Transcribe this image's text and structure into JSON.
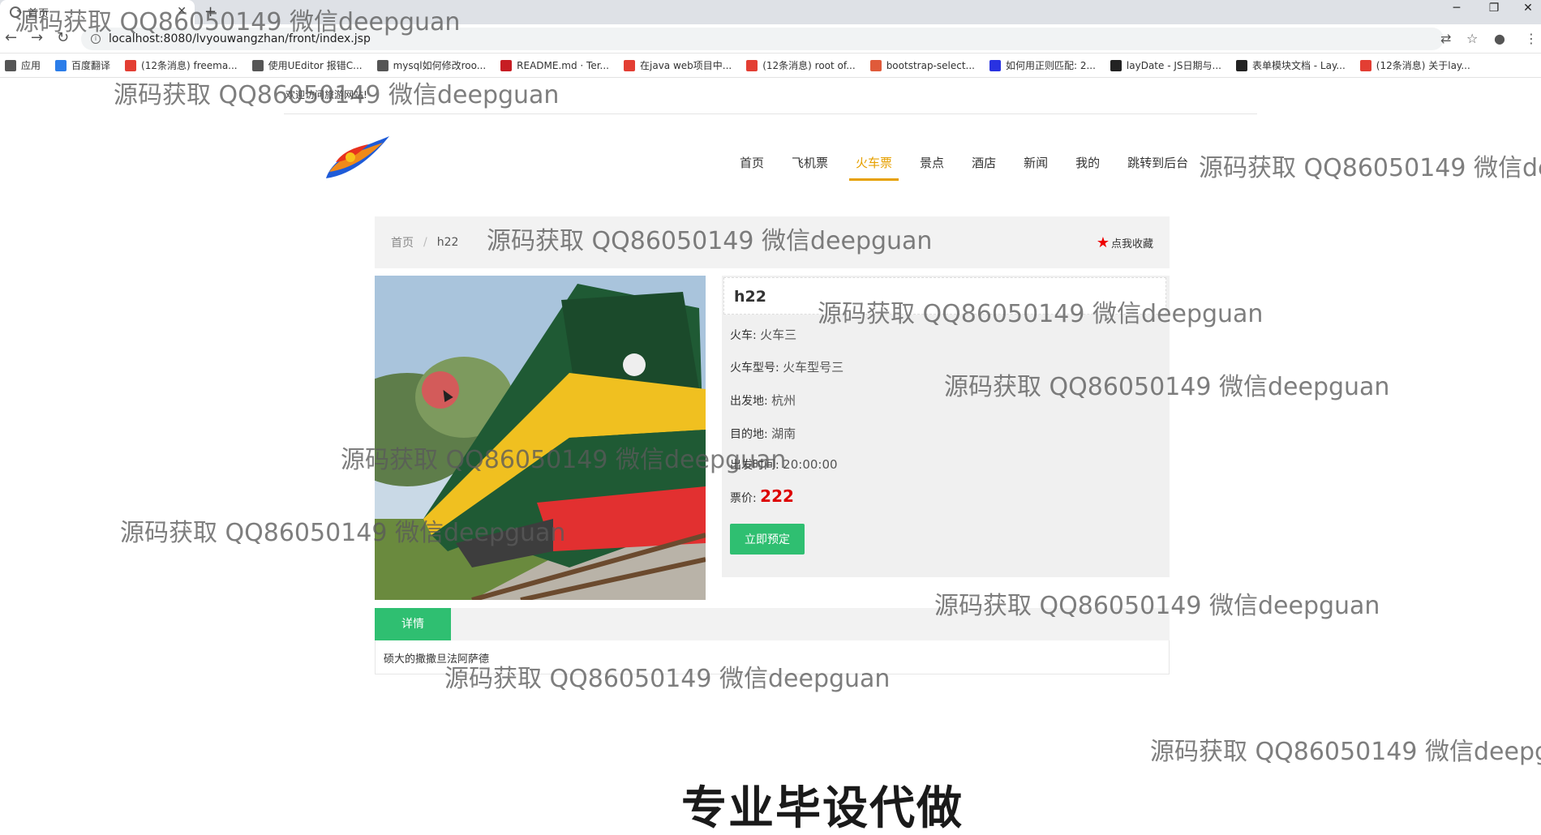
{
  "browser": {
    "tab_title": "首页",
    "url": "localhost:8080/lvyouwangzhan/front/index.jsp",
    "bookmarks": [
      {
        "label": "应用",
        "icon": "apps-icon",
        "color": "#555555"
      },
      {
        "label": "百度翻译",
        "icon": "baidu-translate-icon",
        "color": "#2b7de9"
      },
      {
        "label": "(12条消息) freema...",
        "icon": "csdn-icon",
        "color": "#e33e33"
      },
      {
        "label": "使用UEditor 报错C...",
        "icon": "lambda-icon",
        "color": "#555555"
      },
      {
        "label": "mysql如何修改roo...",
        "icon": "lambda-icon",
        "color": "#555555"
      },
      {
        "label": "README.md · Ter...",
        "icon": "gitee-icon",
        "color": "#c71d23"
      },
      {
        "label": "在java web项目中...",
        "icon": "csdn-icon",
        "color": "#e33e33"
      },
      {
        "label": "(12条消息) root of...",
        "icon": "csdn-icon",
        "color": "#e33e33"
      },
      {
        "label": "bootstrap-select...",
        "icon": "page-icon",
        "color": "#e05a3a"
      },
      {
        "label": "如何用正则匹配: 2...",
        "icon": "baidu-paw-icon",
        "color": "#2932e1"
      },
      {
        "label": "layDate - JS日期与...",
        "icon": "layui-icon",
        "color": "#222222"
      },
      {
        "label": "表单模块文档 - Lay...",
        "icon": "layui-icon",
        "color": "#222222"
      },
      {
        "label": "(12条消息) 关于lay...",
        "icon": "csdn-icon",
        "color": "#e33e33"
      }
    ]
  },
  "site": {
    "welcome": "欢迎访问旅游网站!",
    "nav": [
      {
        "label": "首页",
        "active": false
      },
      {
        "label": "飞机票",
        "active": false
      },
      {
        "label": "火车票",
        "active": true
      },
      {
        "label": "景点",
        "active": false
      },
      {
        "label": "酒店",
        "active": false
      },
      {
        "label": "新闻",
        "active": false
      },
      {
        "label": "我的",
        "active": false
      },
      {
        "label": "跳转到后台",
        "active": false
      }
    ],
    "accent_color": "#e6a000",
    "primary_color": "#2fbf71"
  },
  "breadcrumb": {
    "home": "首页",
    "separator": "/",
    "current": "h22",
    "favorite": "点我收藏"
  },
  "ticket": {
    "title": "h22",
    "train_label": "火车:",
    "train": "火车三",
    "model_label": "火车型号:",
    "model": "火车型号三",
    "from_label": "出发地:",
    "from": "杭州",
    "to_label": "目的地:",
    "to": "湖南",
    "time_label": "出发时间:",
    "time": "20:00:00",
    "price_label": "票价:",
    "price": "222",
    "book_button": "立即预定"
  },
  "details": {
    "tab": "详情",
    "content": "硕大的撒撒旦法阿萨德"
  },
  "overlay": {
    "watermark": "源码获取 QQ86050149 微信deepguan",
    "caption": "专业毕设代做"
  }
}
